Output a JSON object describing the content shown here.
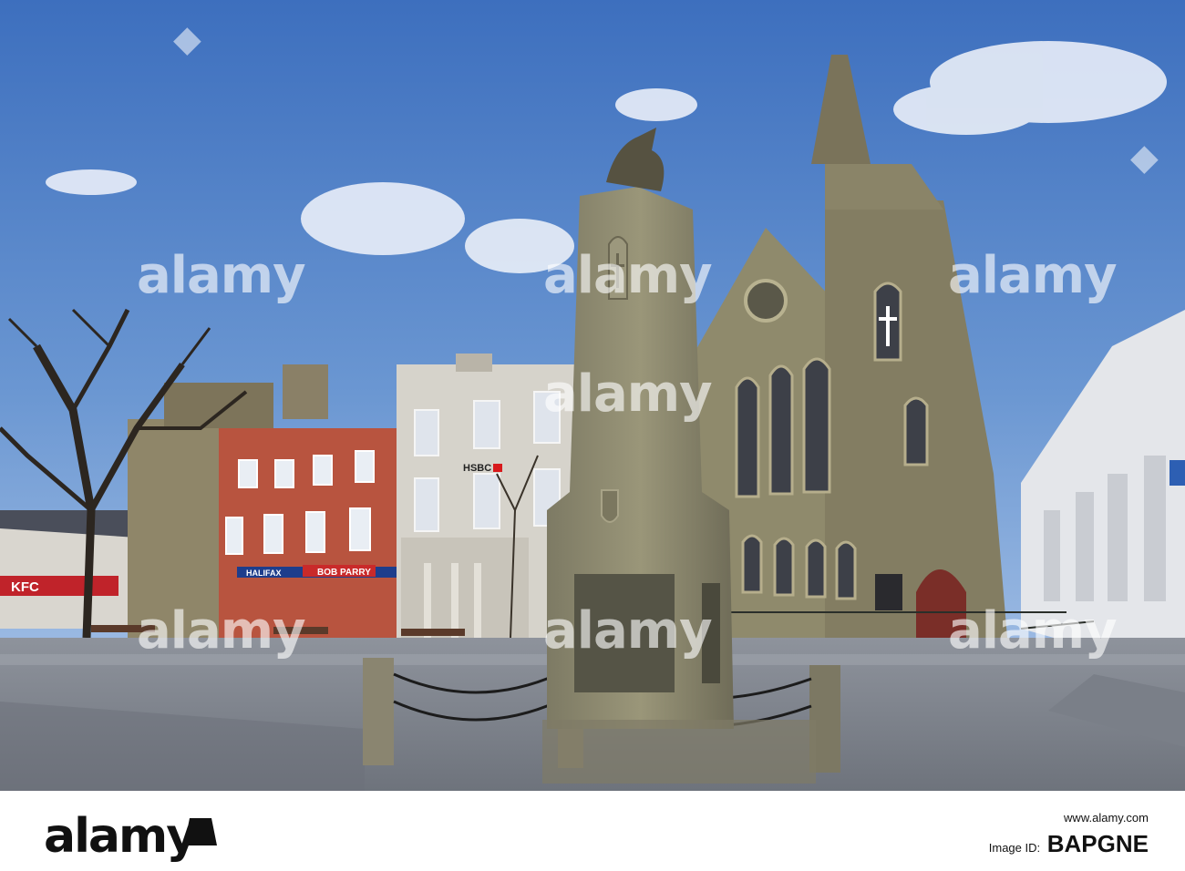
{
  "watermark": {
    "text": "alamy",
    "positions": 9
  },
  "signs": {
    "bank": "HSBC",
    "shop": "BOB PARRY",
    "building_society": "HALIFAX",
    "restaurant": "KFC"
  },
  "footer": {
    "logo": "alamy",
    "url": "www.alamy.com",
    "image_id_label": "Image ID:",
    "image_id": "BAPGNE"
  },
  "colors": {
    "sky": "#4a7fc4",
    "stone": "#8f8a72",
    "brick": "#b8543f",
    "footer_bg": "#ffffff"
  }
}
